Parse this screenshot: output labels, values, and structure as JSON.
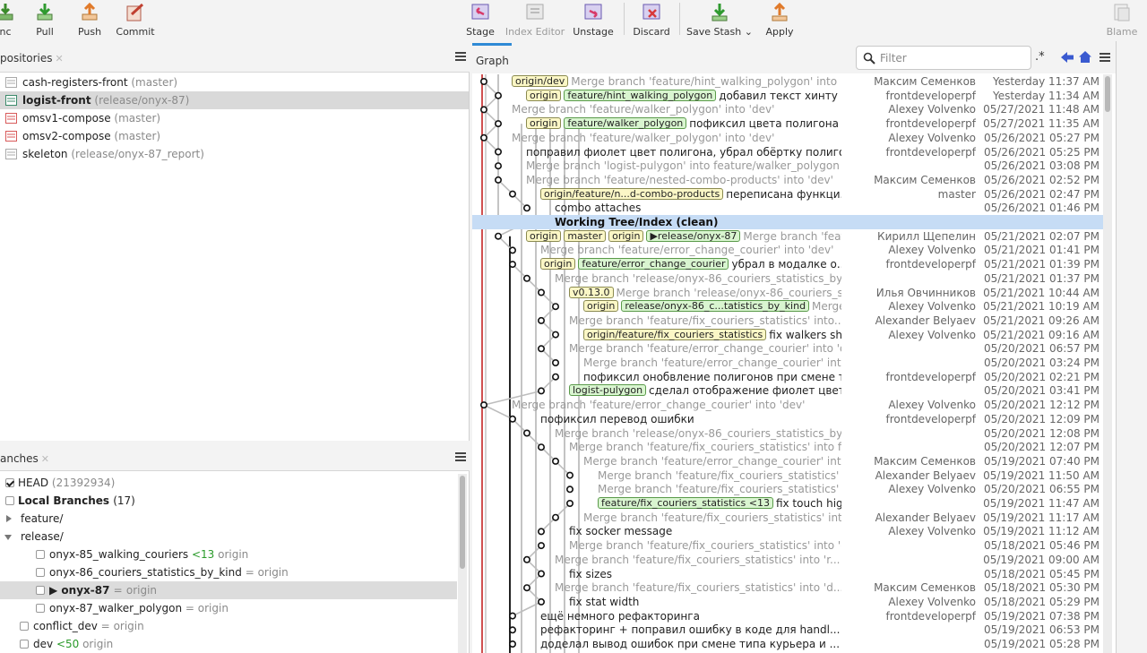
{
  "toolbar": {
    "sync_label": "nc",
    "pull_label": "Pull",
    "push_label": "Push",
    "commit_label": "Commit",
    "stage_label": "Stage",
    "index_editor_label": "Index Editor",
    "unstage_label": "Unstage",
    "discard_label": "Discard",
    "save_stash_label": "Save Stash",
    "apply_label": "Apply",
    "blame_label": "Blame"
  },
  "repos": {
    "title": "positories",
    "items": [
      {
        "name": "cash-registers-front",
        "branch": "(master)",
        "color": "#aaaaaa"
      },
      {
        "name": "logist-front",
        "branch": "(release/onyx-87)",
        "color": "#3a8a6a"
      },
      {
        "name": "omsv1-compose",
        "branch": "(master)",
        "color": "#d85a5a"
      },
      {
        "name": "omsv2-compose",
        "branch": "(master)",
        "color": "#d85a5a"
      },
      {
        "name": "skeleton",
        "branch": "(release/onyx-87_report)",
        "color": "#aaaaaa"
      }
    ]
  },
  "branches": {
    "title": "anches",
    "head_label": "HEAD",
    "head_hash": "(21392934)",
    "local_label": "Local Branches",
    "local_count": "(17)",
    "feature_label": "feature/",
    "release_label": "release/",
    "items": [
      {
        "name": "onyx-85_walking_couriers",
        "status": "<13",
        "remote": "origin"
      },
      {
        "name": "onyx-86_couriers_statistics_by_kind",
        "status": "=",
        "remote": "origin"
      },
      {
        "name": "onyx-87",
        "status": "=",
        "remote": "origin"
      },
      {
        "name": "onyx-87_walker_polygon",
        "status": "=",
        "remote": "origin"
      },
      {
        "name": "conflict_dev",
        "status": "=",
        "remote": "origin"
      },
      {
        "name": "dev",
        "status": "<50",
        "remote": "origin"
      }
    ]
  },
  "graph": {
    "tab_label": "Graph",
    "filter_placeholder": "Filter",
    "regex_label": ".*",
    "rows": [
      {
        "refs": [
          {
            "t": "origin/dev",
            "k": "remote"
          }
        ],
        "msg": "Merge branch 'feature/hint_walking_polygon' into ...",
        "kind": "merge",
        "author": "Максим Семенков",
        "date": "Yesterday 11:37 AM"
      },
      {
        "refs": [
          {
            "t": "origin",
            "k": "remote"
          },
          {
            "t": "feature/hint_walking_polygon",
            "k": "local"
          }
        ],
        "msg": "добавил текст хинту п...",
        "kind": "normal",
        "author": "frontdeveloperpf",
        "date": "Yesterday 11:34 AM"
      },
      {
        "refs": [],
        "msg": "Merge branch 'feature/walker_polygon' into 'dev'",
        "kind": "merge",
        "author": "Alexey Volvenko",
        "date": "05/27/2021 11:48 AM"
      },
      {
        "refs": [
          {
            "t": "origin",
            "k": "remote"
          },
          {
            "t": "feature/walker_polygon",
            "k": "local"
          }
        ],
        "msg": "пофиксил цвета полигона",
        "kind": "normal",
        "author": "frontdeveloperpf",
        "date": "05/27/2021 11:35 AM"
      },
      {
        "refs": [],
        "msg": "Merge branch 'feature/walker_polygon' into 'dev'",
        "kind": "merge",
        "author": "Alexey Volvenko",
        "date": "05/26/2021 05:27 PM"
      },
      {
        "refs": [],
        "msg": "поправил фиолет цвет полигона, убрал обёртку полиго...",
        "kind": "normal",
        "author": "frontdeveloperpf",
        "date": "05/26/2021 05:25 PM"
      },
      {
        "refs": [],
        "msg": "Merge branch 'logist-pulygon' into feature/walker_polygon",
        "kind": "merge",
        "author": "",
        "date": "05/26/2021 03:08 PM"
      },
      {
        "refs": [],
        "msg": "Merge branch 'feature/nested-combo-products' into 'dev'",
        "kind": "merge",
        "author": "Максим Семенков",
        "date": "05/26/2021 02:52 PM"
      },
      {
        "refs": [
          {
            "t": "origin/feature/n...d-combo-products",
            "k": "remote"
          }
        ],
        "msg": "переписана функци...",
        "kind": "normal",
        "author": "master",
        "date": "05/26/2021 02:47 PM"
      },
      {
        "refs": [],
        "msg": "combo attaches",
        "kind": "normal",
        "author": "",
        "date": "05/26/2021 01:46 PM"
      },
      {
        "refs": [],
        "msg": "Working Tree/Index (clean)",
        "kind": "wt",
        "author": "",
        "date": ""
      },
      {
        "refs": [
          {
            "t": "origin",
            "k": "remote"
          },
          {
            "t": "master",
            "k": "remote"
          },
          {
            "t": "origin",
            "k": "remote"
          },
          {
            "t": "▶release/onyx-87",
            "k": "local"
          }
        ],
        "msg": "Merge branch 'feature/fea...",
        "kind": "merge",
        "author": "Кирилл Щепелин",
        "date": "05/21/2021 02:07 PM"
      },
      {
        "refs": [],
        "msg": "Merge branch 'feature/error_change_courier' into 'dev'",
        "kind": "merge",
        "author": "Alexey Volvenko",
        "date": "05/21/2021 01:41 PM"
      },
      {
        "refs": [
          {
            "t": "origin",
            "k": "remote"
          },
          {
            "t": "feature/error_change_courier",
            "k": "local"
          }
        ],
        "msg": "убрал в модалке о...",
        "kind": "normal",
        "author": "frontdeveloperpf",
        "date": "05/21/2021 01:39 PM"
      },
      {
        "refs": [],
        "msg": "Merge branch 'release/onyx-86_couriers_statistics_by_...",
        "kind": "merge",
        "author": "",
        "date": "05/21/2021 01:37 PM"
      },
      {
        "refs": [
          {
            "t": "v0.13.0",
            "k": "remote"
          }
        ],
        "msg": "Merge branch 'release/onyx-86_couriers_s...",
        "kind": "merge",
        "author": "Илья Овчинников",
        "date": "05/21/2021 10:44 AM"
      },
      {
        "refs": [
          {
            "t": "origin",
            "k": "remote"
          },
          {
            "t": "release/onyx-86_c...tatistics_by_kind",
            "k": "local"
          }
        ],
        "msg": "Merge bra...",
        "kind": "merge",
        "author": "Alexey Volvenko",
        "date": "05/21/2021 10:19 AM"
      },
      {
        "refs": [],
        "msg": "Merge branch 'feature/fix_couriers_statistics' into...",
        "kind": "merge",
        "author": "Alexander Belyaev",
        "date": "05/21/2021 09:26 AM"
      },
      {
        "refs": [
          {
            "t": "origin/feature/fix_couriers_statistics",
            "k": "remote"
          }
        ],
        "msg": "fix walkers sh...",
        "kind": "normal",
        "author": "Alexey Volvenko",
        "date": "05/21/2021 09:16 AM"
      },
      {
        "refs": [],
        "msg": "Merge branch 'feature/error_change_courier' into 'dev'",
        "kind": "merge",
        "author": "",
        "date": "05/20/2021 06:57 PM"
      },
      {
        "refs": [],
        "msg": "Merge branch 'feature/error_change_courier' into 'd...",
        "kind": "merge",
        "author": "",
        "date": "05/20/2021 03:24 PM"
      },
      {
        "refs": [],
        "msg": "пофиксил онобвление полигонов при смене тип...",
        "kind": "normal",
        "author": "frontdeveloperpf",
        "date": "05/20/2021 02:21 PM"
      },
      {
        "refs": [
          {
            "t": "logist-pulygon",
            "k": "local"
          }
        ],
        "msg": "сделал отображение фиолет цвет...",
        "kind": "normal",
        "author": "",
        "date": "05/20/2021 03:41 PM"
      },
      {
        "refs": [],
        "msg": "Merge branch 'feature/error_change_courier' into 'dev'",
        "kind": "merge",
        "author": "Alexey Volvenko",
        "date": "05/20/2021 12:12 PM"
      },
      {
        "refs": [],
        "msg": "пофиксил перевод ошибки",
        "kind": "normal",
        "author": "frontdeveloperpf",
        "date": "05/20/2021 12:09 PM"
      },
      {
        "refs": [],
        "msg": "Merge branch 'release/onyx-86_couriers_statistics_by_...",
        "kind": "merge",
        "author": "",
        "date": "05/20/2021 12:08 PM"
      },
      {
        "refs": [],
        "msg": "Merge branch 'feature/fix_couriers_statistics' into fe...",
        "kind": "merge",
        "author": "",
        "date": "05/20/2021 12:07 PM"
      },
      {
        "refs": [],
        "msg": "Merge branch 'feature/error_change_courier' into...",
        "kind": "merge",
        "author": "Максим Семенков",
        "date": "05/19/2021 07:40 PM"
      },
      {
        "refs": [],
        "msg": "Merge branch 'feature/fix_couriers_statistics' into...",
        "kind": "merge",
        "author": "Alexander Belyaev",
        "date": "05/19/2021 11:50 AM"
      },
      {
        "refs": [],
        "msg": "Merge branch 'feature/fix_couriers_statistics' into...",
        "kind": "merge",
        "author": "Alexey Volvenko",
        "date": "05/20/2021 06:55 PM"
      },
      {
        "refs": [
          {
            "t": "feature/fix_couriers_statistics <13",
            "k": "local"
          }
        ],
        "msg": "fix touch highlight",
        "kind": "normal",
        "author": "",
        "date": "05/19/2021 11:47 AM"
      },
      {
        "refs": [],
        "msg": "Merge branch 'feature/fix_couriers_statistics' into 'd...",
        "kind": "merge",
        "author": "Alexander Belyaev",
        "date": "05/19/2021 11:17 AM"
      },
      {
        "refs": [],
        "msg": "fix socker message",
        "kind": "normal",
        "author": "Alexey Volvenko",
        "date": "05/19/2021 11:12 AM"
      },
      {
        "refs": [],
        "msg": "Merge branch 'feature/fix_couriers_statistics' into 'd...",
        "kind": "merge",
        "author": "",
        "date": "05/18/2021 05:46 PM"
      },
      {
        "refs": [],
        "msg": "Merge branch 'feature/fix_couriers_statistics' into 'r...",
        "kind": "merge",
        "author": "",
        "date": "05/19/2021 09:00 AM"
      },
      {
        "refs": [],
        "msg": "fix sizes",
        "kind": "normal",
        "author": "",
        "date": "05/18/2021 05:45 PM"
      },
      {
        "refs": [],
        "msg": "Merge branch 'feature/fix_couriers_statistics' into 'd...",
        "kind": "merge",
        "author": "Максим Семенков",
        "date": "05/18/2021 05:30 PM"
      },
      {
        "refs": [],
        "msg": "fix stat width",
        "kind": "normal",
        "author": "Alexey Volvenko",
        "date": "05/18/2021 05:29 PM"
      },
      {
        "refs": [],
        "msg": "ещё немного рефакторинга",
        "kind": "normal",
        "author": "frontdeveloperpf",
        "date": "05/19/2021 07:38 PM"
      },
      {
        "refs": [],
        "msg": "рефакторинг + поправил ошибку в коде для handl...",
        "kind": "normal",
        "author": "",
        "date": "05/19/2021 06:53 PM"
      },
      {
        "refs": [],
        "msg": "доделал вывод ошибок при смене типа курьера и ...",
        "kind": "normal",
        "author": "",
        "date": "05/19/2021 05:28 PM"
      }
    ]
  }
}
